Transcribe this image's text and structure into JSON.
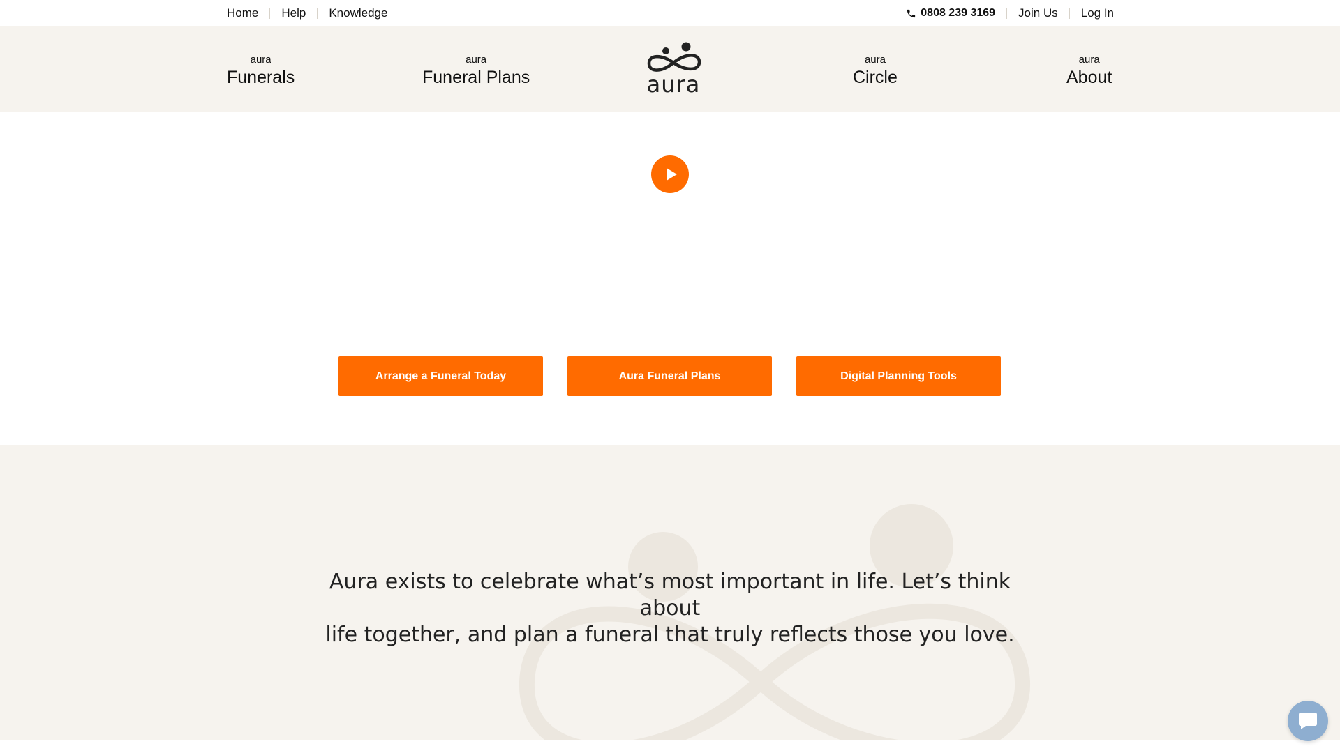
{
  "topbar": {
    "left_links": [
      "Home",
      "Help",
      "Knowledge"
    ],
    "phone": "0808 239 3169",
    "join": "Join Us",
    "login": "Log In"
  },
  "nav": {
    "items": [
      {
        "small": "aura",
        "big": "Funerals"
      },
      {
        "small": "aura",
        "big": "Funeral Plans"
      },
      {
        "small": "aura",
        "big": "Circle"
      },
      {
        "small": "aura",
        "big": "About"
      }
    ],
    "logo_text": "aura"
  },
  "hero": {
    "buttons": [
      "Arrange a Funeral Today",
      "Aura Funeral Plans",
      "Digital Planning Tools"
    ]
  },
  "mission": {
    "line1": "Aura exists to celebrate what’s most important in life. Let’s think about",
    "line2": "life together, and plan a funeral that truly reflects those you love."
  },
  "colors": {
    "accent": "#ff6b00",
    "beige": "#f6f3ee",
    "chat": "#8eaed0"
  },
  "icons": {
    "phone": "phone-icon",
    "play": "play-icon",
    "chat": "chat-icon",
    "logo": "aura-infinity-logo"
  }
}
